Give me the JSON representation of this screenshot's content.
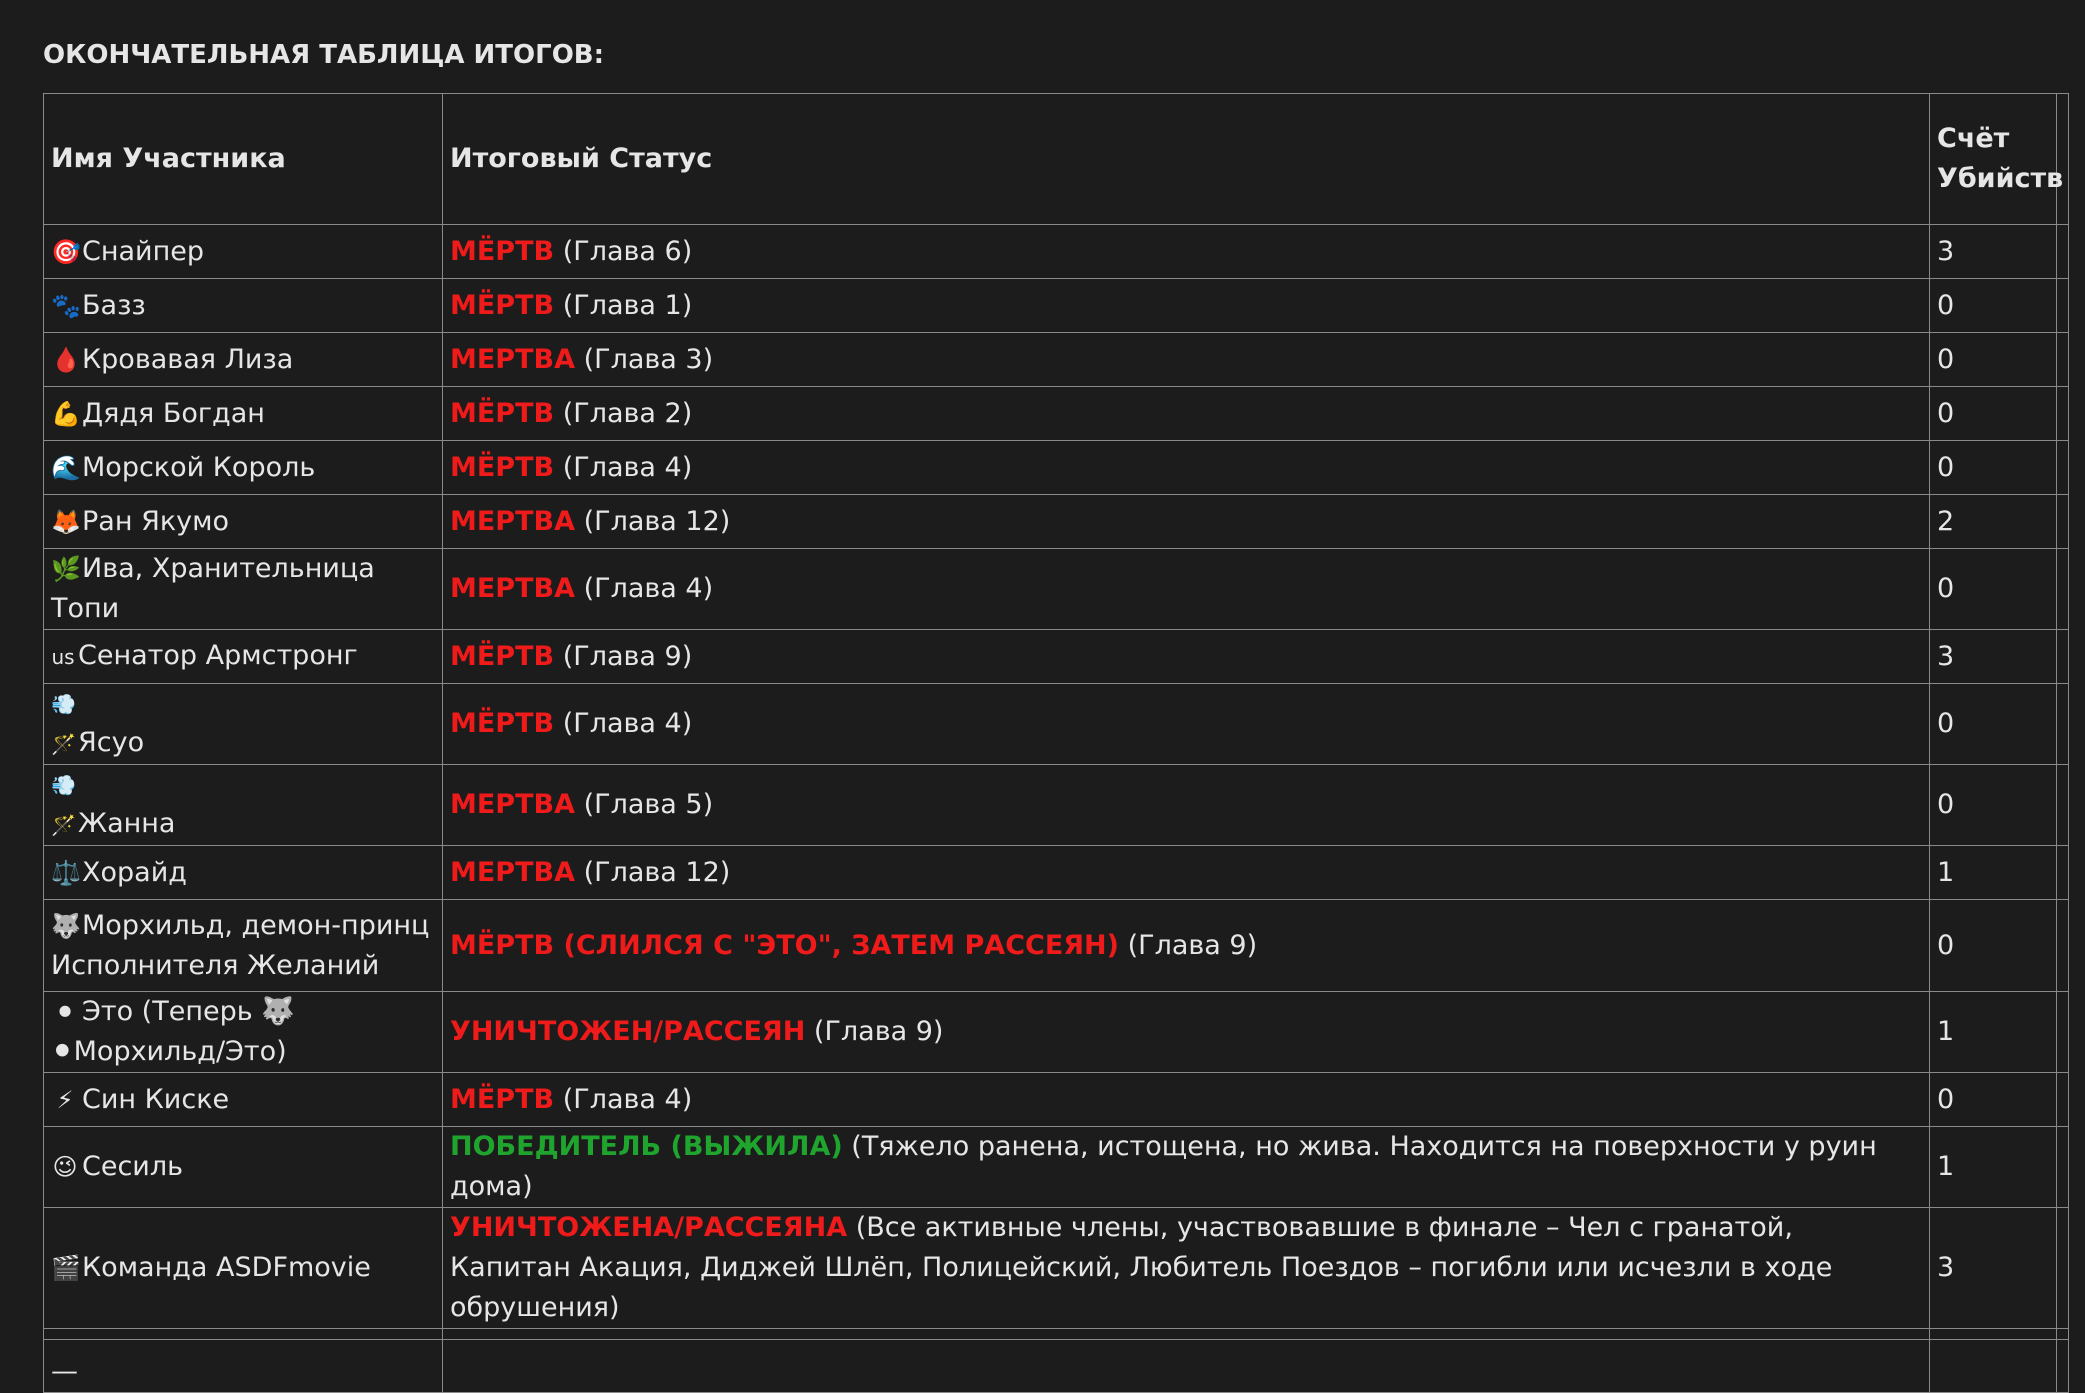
{
  "heading": "ОКОНЧАТЕЛЬНАЯ ТАБЛИЦА ИТОГОВ:",
  "columns": {
    "name": "Имя Участника",
    "status": "Итоговый Статус",
    "kills": "Счёт Убийств"
  },
  "rows": [
    {
      "icon": "🎯",
      "icon_name": "target-icon",
      "name": "Снайпер",
      "status": "МЁРТВ",
      "status_color": "#ef1a1a",
      "note": "(Глава 6)",
      "kills": "3"
    },
    {
      "icon": "🐾",
      "icon_name": "paw-prints-icon",
      "name": "Базз",
      "status": "МЁРТВ",
      "status_color": "#ef1a1a",
      "note": "(Глава 1)",
      "kills": "0"
    },
    {
      "icon": "🩸",
      "icon_name": "blood-drop-icon",
      "name": "Кровавая Лиза",
      "status": "МЕРТВА",
      "status_color": "#ef1a1a",
      "note": "(Глава 3)",
      "kills": "0"
    },
    {
      "icon": "💪",
      "icon_name": "flexed-biceps-icon",
      "name": "Дядя Богдан",
      "status": "МЁРТВ",
      "status_color": "#ef1a1a",
      "note": "(Глава 2)",
      "kills": "0"
    },
    {
      "icon": "🌊",
      "icon_name": "wave-icon",
      "name": "Морской Король",
      "status": "МЁРТВ",
      "status_color": "#ef1a1a",
      "note": "(Глава 4)",
      "kills": "0"
    },
    {
      "icon": "🦊",
      "icon_name": "fox-icon",
      "name": "Ран Якумо",
      "status": "МЕРТВА",
      "status_color": "#ef1a1a",
      "note": "(Глава 12)",
      "kills": "2"
    },
    {
      "icon": "🌿",
      "icon_name": "herb-icon",
      "name": "Ива, Хранительница Топи",
      "status": "МЕРТВА",
      "status_color": "#ef1a1a",
      "note": "(Глава 4)",
      "kills": "0"
    },
    {
      "icon": "us",
      "icon_name": "us-flag-icon",
      "name": "Сенатор Армстронг",
      "status": "МЁРТВ",
      "status_color": "#ef1a1a",
      "note": "(Глава 9)",
      "kills": "3"
    },
    {
      "icon": "💨🪄",
      "icon_name": "dash-wand-icon",
      "name": "Ясуо",
      "status": "МЁРТВ",
      "status_color": "#ef1a1a",
      "note": "(Глава 4)",
      "kills": "0"
    },
    {
      "icon": "💨🪄",
      "icon_name": "dash-wand-icon",
      "name": "Жанна",
      "status": "МЕРТВА",
      "status_color": "#ef1a1a",
      "note": "(Глава 5)",
      "kills": "0"
    },
    {
      "icon": "⚖️",
      "icon_name": "scales-icon",
      "name": "Хорайд",
      "status": "МЕРТВА",
      "status_color": "#ef1a1a",
      "note": "(Глава 12)",
      "kills": "1"
    },
    {
      "icon": "🐺",
      "icon_name": "wolf-icon",
      "name": "Морхильд, демон-принц Исполнителя Желаний",
      "status": "МЁРТВ (СЛИЛСЯ С \"ЭТО\", ЗАТЕМ РАССЕЯН)",
      "status_color": "#ef1a1a",
      "note": "(Глава 9)",
      "kills": "0"
    },
    {
      "icon": "⚫",
      "icon_name": "black-circle-icon",
      "name": "Это (Теперь 🐺 ⚫Морхильд/Это)",
      "status": "УНИЧТОЖЕН/РАССЕЯН",
      "status_color": "#ef1a1a",
      "note": "(Глава 9)",
      "kills": "1"
    },
    {
      "icon": "⚡",
      "icon_name": "lightning-icon",
      "name": "Син Киске",
      "status": "МЁРТВ",
      "status_color": "#ef1a1a",
      "note": "(Глава 4)",
      "kills": "0"
    },
    {
      "icon": "😉",
      "icon_name": "winking-face-icon",
      "name": "Сесиль",
      "status": "ПОБЕДИТЕЛЬ (ВЫЖИЛА)",
      "status_color": "#1fa52e",
      "note": "(Тяжело ранена, истощена, но жива. Находится на поверхности у руин дома)",
      "kills": "1"
    },
    {
      "icon": "🎬",
      "icon_name": "clapper-board-icon",
      "name": "Команда ASDFmovie",
      "status": "УНИЧТОЖЕНА/РАССЕЯНА",
      "status_color": "#ef1a1a",
      "note": "(Все активные члены, участвовавшие в финале – Чел с гранатой, Капитан Акация, Диджей Шлёп, Полицейский, Любитель Поездов – погибли или исчезли в ходе обрушения)",
      "kills": "3"
    }
  ],
  "footer_mark": "—"
}
